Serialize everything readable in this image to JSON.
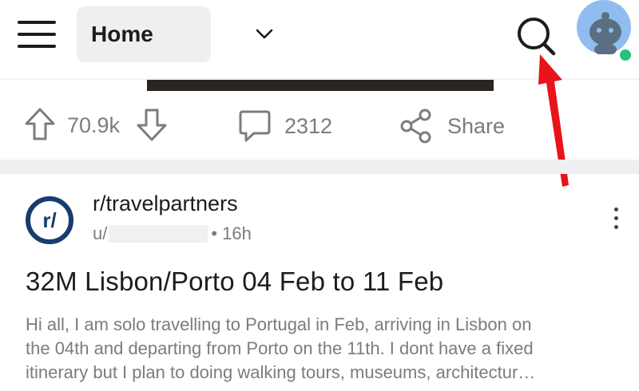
{
  "header": {
    "feed_label": "Home"
  },
  "previous_post": {
    "upvotes": "70.9k",
    "comments": "2312",
    "share_label": "Share"
  },
  "post": {
    "community": "r/travelpartners",
    "community_icon_text": "r/",
    "user_prefix": "u/",
    "age": "• 16h",
    "title": "32M Lisbon/Porto 04 Feb to 11 Feb",
    "body_lines": [
      "Hi all, I am solo travelling to Portugal in Feb, arriving in Lisbon on",
      "the 04th and departing from Porto on the 11th. I dont have a fixed",
      "itinerary but I plan to doing walking tours, museums, architectur…"
    ]
  },
  "colors": {
    "accent_arrow": "#e8131b",
    "community_icon": "#163d6e",
    "online": "#24c27a",
    "avatar_bg": "#8fbdf0"
  },
  "icons": [
    "menu-icon",
    "chevron-down-icon",
    "search-icon",
    "avatar-icon",
    "upvote-icon",
    "downvote-icon",
    "comment-icon",
    "share-icon",
    "more-vertical-icon"
  ]
}
